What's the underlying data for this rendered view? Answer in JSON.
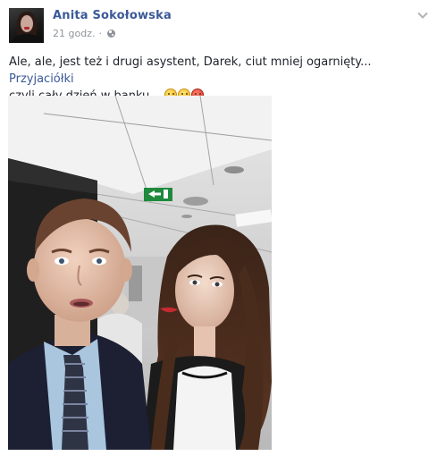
{
  "post": {
    "author": "Anita Sokołowska",
    "timestamp": "21 godz.",
    "separator": "·",
    "privacy_icon": "globe-icon",
    "menu_icon": "chevron-down-icon",
    "text_part1": "Ale, ale, jest też i drugi asystent, Darek, ciut mniej ogarnięty... ",
    "text_link": "Przyjaciółki",
    "text_part2": " czyli cały dzień w banku... ",
    "emojis": [
      "flushed-emoji-icon",
      "grimace-emoji-icon",
      "angry-emoji-icon"
    ],
    "exit_sign_label": "←⌐"
  },
  "colors": {
    "link": "#3b5998",
    "meta": "#90949c",
    "text": "#1d2129"
  }
}
